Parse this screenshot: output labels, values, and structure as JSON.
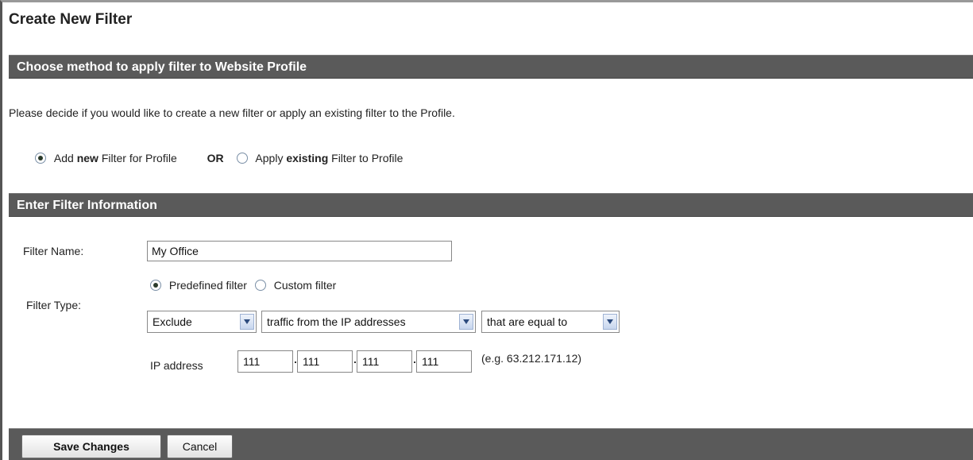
{
  "page": {
    "title": "Create New Filter"
  },
  "method_section": {
    "heading": "Choose method to apply filter to Website Profile",
    "instruction": "Please decide if you would like to create a new filter or apply an existing filter to the Profile.",
    "option_new": {
      "prefix": "Add",
      "bold": "new",
      "suffix": "Filter for Profile",
      "selected": true
    },
    "or_label": "OR",
    "option_existing": {
      "prefix": "Apply",
      "bold": "existing",
      "suffix": "Filter to Profile",
      "selected": false
    }
  },
  "filter_section": {
    "heading": "Enter Filter Information",
    "name_label": "Filter Name:",
    "name_value": "My Office",
    "type_label": "Filter Type:",
    "predefined_label": "Predefined filter",
    "predefined_selected": true,
    "custom_label": "Custom filter",
    "custom_selected": false,
    "select_action": "Exclude",
    "select_source": "traffic from the IP addresses",
    "select_match": "that are equal to",
    "ip_label": "IP address",
    "ip_octets": [
      "111",
      "111",
      "111",
      "111"
    ],
    "ip_example": "(e.g. 63.212.171.12)"
  },
  "footer": {
    "save_label": "Save Changes",
    "cancel_label": "Cancel"
  },
  "colors": {
    "section_bar": "#5a5a5a",
    "radio_border": "#7a8fa6",
    "select_arrow": "#2c4b7e"
  },
  "icons": {
    "dropdown": "chevron-down-icon"
  }
}
